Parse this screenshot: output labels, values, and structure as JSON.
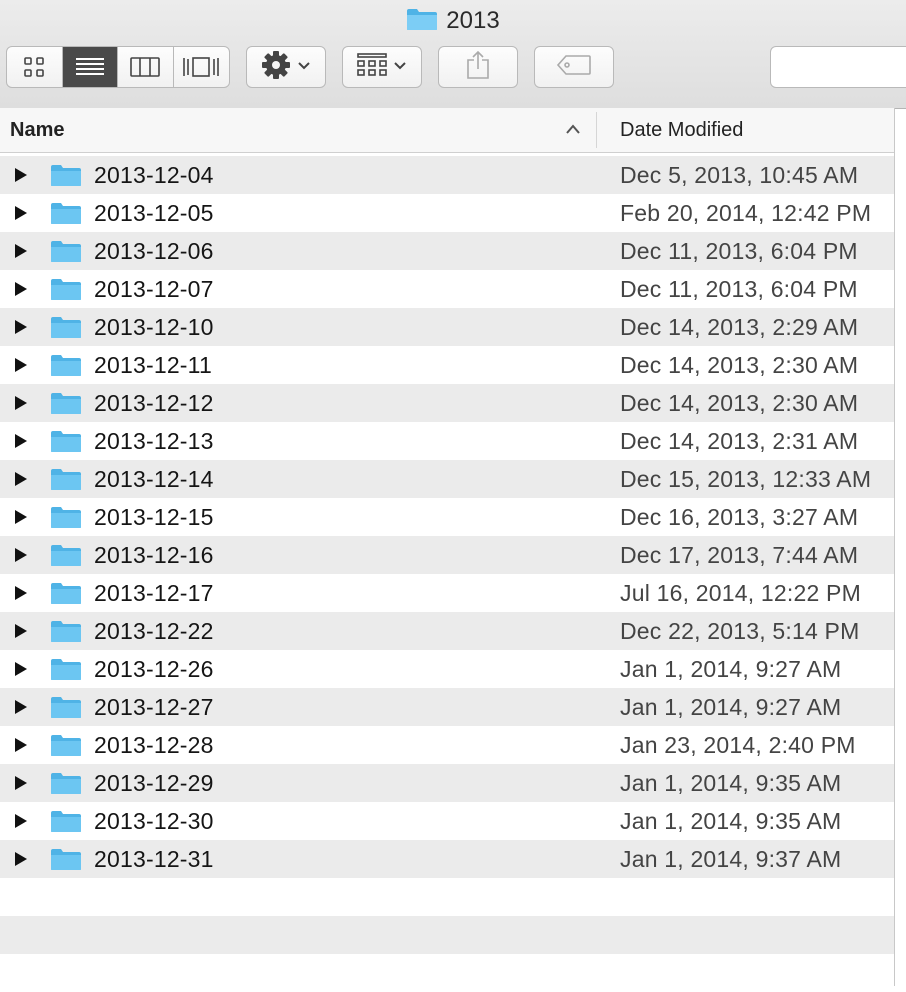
{
  "window": {
    "title": "2013",
    "title_icon": "folder-icon"
  },
  "toolbar": {
    "view_modes": [
      "icon-view-icon",
      "list-view-icon",
      "column-view-icon",
      "cover-flow-icon"
    ],
    "active_view": "list-view-icon",
    "action_icon": "gear-icon",
    "arrange_icon": "arrange-grid-icon",
    "share_icon": "share-icon",
    "tag_icon": "tag-icon",
    "search_value": ""
  },
  "columns": {
    "name": "Name",
    "date": "Date Modified",
    "sort_icon": "chevron-up-icon"
  },
  "rows": [
    {
      "name": "2013-12-04",
      "date": "Dec 5, 2013, 10:45 AM"
    },
    {
      "name": "2013-12-05",
      "date": "Feb 20, 2014, 12:42 PM"
    },
    {
      "name": "2013-12-06",
      "date": "Dec 11, 2013, 6:04 PM"
    },
    {
      "name": "2013-12-07",
      "date": "Dec 11, 2013, 6:04 PM"
    },
    {
      "name": "2013-12-10",
      "date": "Dec 14, 2013, 2:29 AM"
    },
    {
      "name": "2013-12-11",
      "date": "Dec 14, 2013, 2:30 AM"
    },
    {
      "name": "2013-12-12",
      "date": "Dec 14, 2013, 2:30 AM"
    },
    {
      "name": "2013-12-13",
      "date": "Dec 14, 2013, 2:31 AM"
    },
    {
      "name": "2013-12-14",
      "date": "Dec 15, 2013, 12:33 AM"
    },
    {
      "name": "2013-12-15",
      "date": "Dec 16, 2013, 3:27 AM"
    },
    {
      "name": "2013-12-16",
      "date": "Dec 17, 2013, 7:44 AM"
    },
    {
      "name": "2013-12-17",
      "date": "Jul 16, 2014, 12:22 PM"
    },
    {
      "name": "2013-12-22",
      "date": "Dec 22, 2013, 5:14 PM"
    },
    {
      "name": "2013-12-26",
      "date": "Jan 1, 2014, 9:27 AM"
    },
    {
      "name": "2013-12-27",
      "date": "Jan 1, 2014, 9:27 AM"
    },
    {
      "name": "2013-12-28",
      "date": "Jan 23, 2014, 2:40 PM"
    },
    {
      "name": "2013-12-29",
      "date": "Jan 1, 2014, 9:35 AM"
    },
    {
      "name": "2013-12-30",
      "date": "Jan 1, 2014, 9:35 AM"
    },
    {
      "name": "2013-12-31",
      "date": "Jan 1, 2014, 9:37 AM"
    }
  ],
  "colors": {
    "folder": "#6cc6f2",
    "folder_dark": "#4fb3e6",
    "stripe": "#ebebeb",
    "active_segment": "#4a4a4a"
  }
}
